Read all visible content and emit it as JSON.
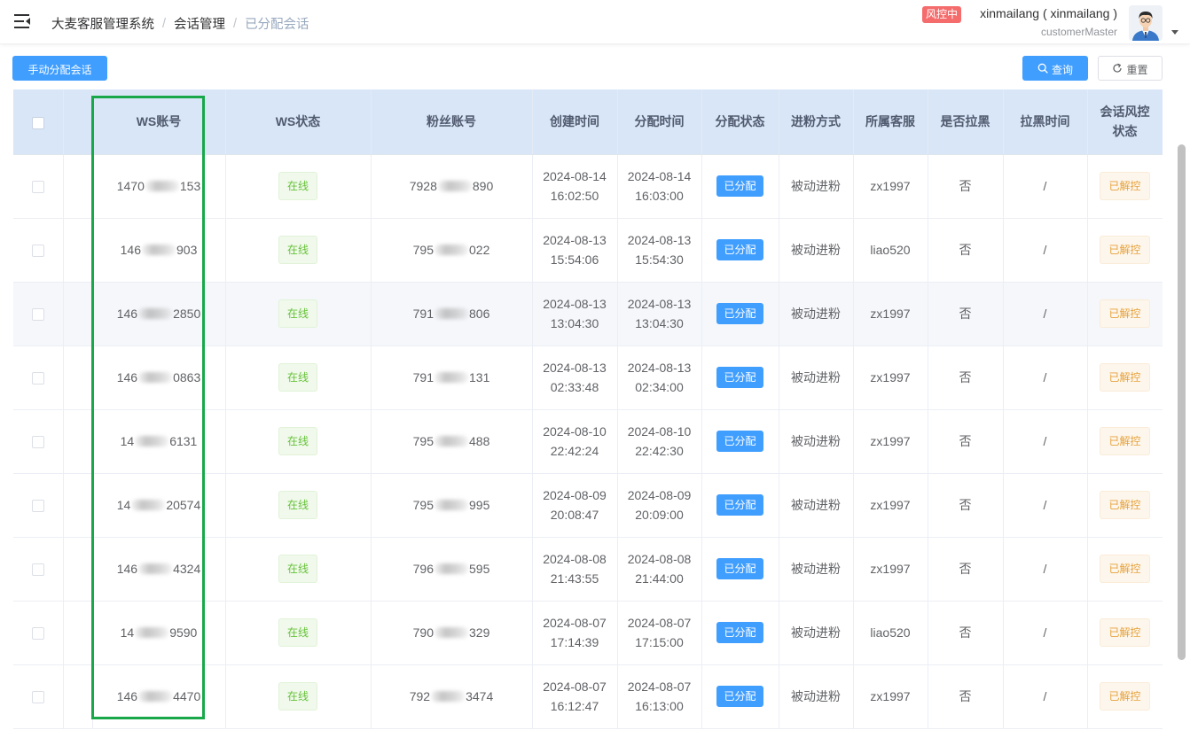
{
  "breadcrumb": {
    "app": "大麦客服管理系统",
    "section": "会话管理",
    "page": "已分配会话"
  },
  "user": {
    "risk_badge": "风控中",
    "name": "xinmailang ( xinmailang )",
    "role": "customerMaster"
  },
  "toolbar": {
    "assign_label": "手动分配会话",
    "search_label": "查询",
    "reset_label": "重置"
  },
  "table": {
    "headers": {
      "ws_account": "WS账号",
      "ws_status": "WS状态",
      "fan_account": "粉丝账号",
      "created": "创建时间",
      "assigned": "分配时间",
      "assign_status": "分配状态",
      "source": "进粉方式",
      "agent": "所属客服",
      "blacklisted": "是否拉黑",
      "blacklist_time": "拉黑时间",
      "risk_line1": "会话风控",
      "risk_line2": "状态"
    },
    "rows": [
      {
        "ws_pre": "1470",
        "ws_suf": "153",
        "status": "在线",
        "fan_pre": "7928",
        "fan_suf": "890",
        "created_date": "2024-08-14",
        "created_time": "16:02:50",
        "assigned_date": "2024-08-14",
        "assigned_time": "16:03:00",
        "assign_status": "已分配",
        "source": "被动进粉",
        "agent": "zx1997",
        "blacklisted": "否",
        "blacklist_time": "/",
        "risk": "已解控"
      },
      {
        "ws_pre": "146",
        "ws_suf": "903",
        "status": "在线",
        "fan_pre": "795",
        "fan_suf": "022",
        "created_date": "2024-08-13",
        "created_time": "15:54:06",
        "assigned_date": "2024-08-13",
        "assigned_time": "15:54:30",
        "assign_status": "已分配",
        "source": "被动进粉",
        "agent": "liao520",
        "blacklisted": "否",
        "blacklist_time": "/",
        "risk": "已解控"
      },
      {
        "ws_pre": "146",
        "ws_suf": "2850",
        "status": "在线",
        "fan_pre": "791",
        "fan_suf": "806",
        "created_date": "2024-08-13",
        "created_time": "13:04:30",
        "assigned_date": "2024-08-13",
        "assigned_time": "13:04:30",
        "assign_status": "已分配",
        "source": "被动进粉",
        "agent": "zx1997",
        "blacklisted": "否",
        "blacklist_time": "/",
        "risk": "已解控"
      },
      {
        "ws_pre": "146",
        "ws_suf": "0863",
        "status": "在线",
        "fan_pre": "791",
        "fan_suf": "131",
        "created_date": "2024-08-13",
        "created_time": "02:33:48",
        "assigned_date": "2024-08-13",
        "assigned_time": "02:34:00",
        "assign_status": "已分配",
        "source": "被动进粉",
        "agent": "zx1997",
        "blacklisted": "否",
        "blacklist_time": "/",
        "risk": "已解控"
      },
      {
        "ws_pre": "14",
        "ws_suf": "6131",
        "status": "在线",
        "fan_pre": "795",
        "fan_suf": "488",
        "created_date": "2024-08-10",
        "created_time": "22:42:24",
        "assigned_date": "2024-08-10",
        "assigned_time": "22:42:30",
        "assign_status": "已分配",
        "source": "被动进粉",
        "agent": "zx1997",
        "blacklisted": "否",
        "blacklist_time": "/",
        "risk": "已解控"
      },
      {
        "ws_pre": "14",
        "ws_suf": "20574",
        "status": "在线",
        "fan_pre": "795",
        "fan_suf": "995",
        "created_date": "2024-08-09",
        "created_time": "20:08:47",
        "assigned_date": "2024-08-09",
        "assigned_time": "20:09:00",
        "assign_status": "已分配",
        "source": "被动进粉",
        "agent": "zx1997",
        "blacklisted": "否",
        "blacklist_time": "/",
        "risk": "已解控"
      },
      {
        "ws_pre": "146",
        "ws_suf": "4324",
        "status": "在线",
        "fan_pre": "796",
        "fan_suf": "595",
        "created_date": "2024-08-08",
        "created_time": "21:43:55",
        "assigned_date": "2024-08-08",
        "assigned_time": "21:44:00",
        "assign_status": "已分配",
        "source": "被动进粉",
        "agent": "zx1997",
        "blacklisted": "否",
        "blacklist_time": "/",
        "risk": "已解控"
      },
      {
        "ws_pre": "14",
        "ws_suf": "9590",
        "status": "在线",
        "fan_pre": "790",
        "fan_suf": "329",
        "created_date": "2024-08-07",
        "created_time": "17:14:39",
        "assigned_date": "2024-08-07",
        "assigned_time": "17:15:00",
        "assign_status": "已分配",
        "source": "被动进粉",
        "agent": "liao520",
        "blacklisted": "否",
        "blacklist_time": "/",
        "risk": "已解控"
      },
      {
        "ws_pre": "146",
        "ws_suf": "4470",
        "status": "在线",
        "fan_pre": "792",
        "fan_suf": "3474",
        "created_date": "2024-08-07",
        "created_time": "16:12:47",
        "assigned_date": "2024-08-07",
        "assigned_time": "16:13:00",
        "assign_status": "已分配",
        "source": "被动进粉",
        "agent": "zx1997",
        "blacklisted": "否",
        "blacklist_time": "/",
        "risk": "已解控"
      }
    ]
  },
  "colors": {
    "primary": "#409eff",
    "risk_badge": "#f56c6c",
    "online": "#67c23a",
    "released": "#e6a23c",
    "highlight": "#18a84a",
    "header_bg": "#d8e6f8"
  }
}
